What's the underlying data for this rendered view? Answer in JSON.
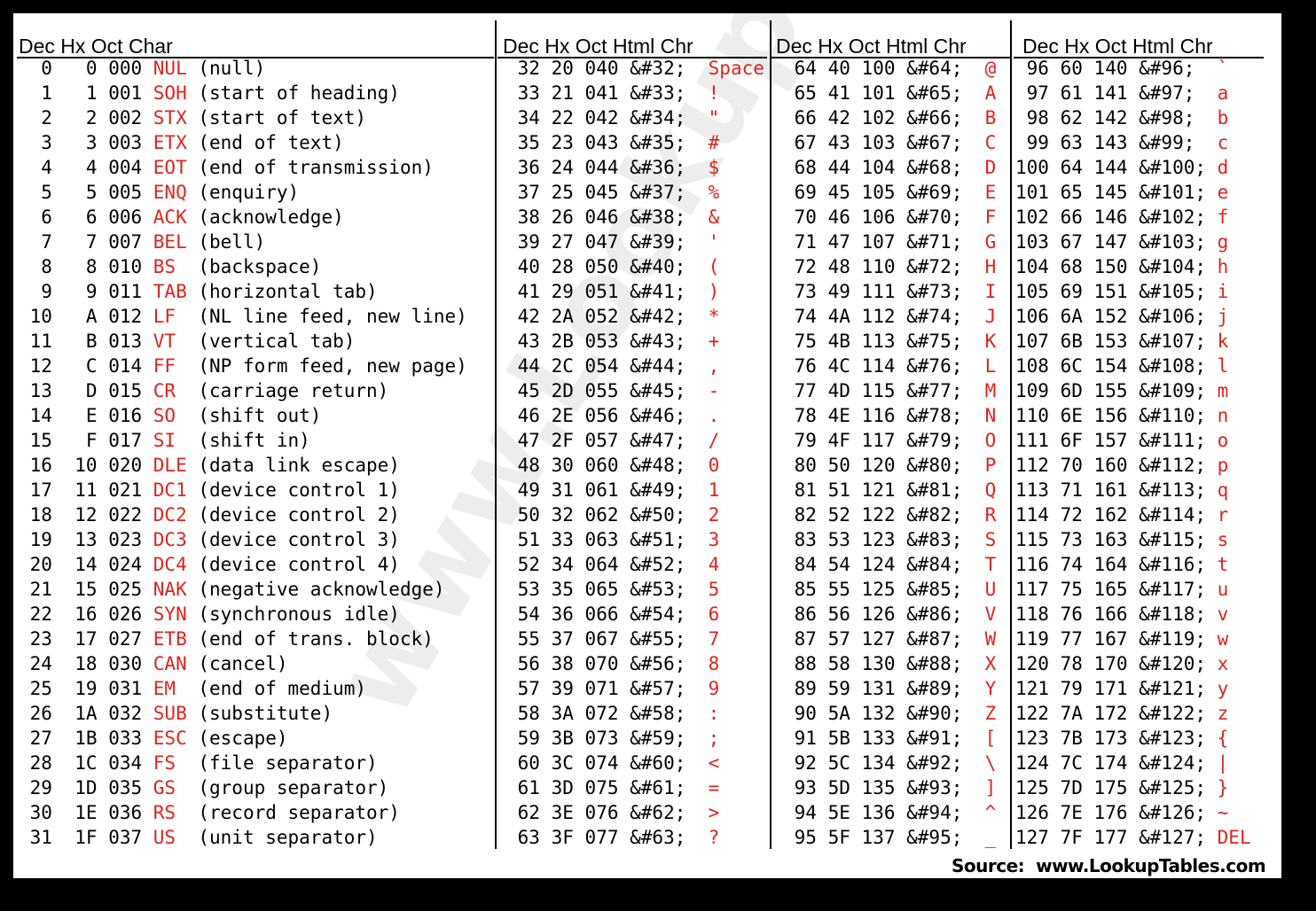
{
  "watermark": "www.LookupTables.com",
  "source": "Source:  www.LookupTables.com",
  "colors": {
    "code_red": "#e0241c"
  },
  "headers": [
    "Dec  Hx Oct  Char",
    "Dec  Hx  Oct   Html   Chr",
    "Dec  Hx  Oct  Html   Chr",
    "Dec  Hx  Oct  Html  Chr"
  ],
  "control_rows": [
    {
      "dec": "0",
      "hex": "0",
      "oct": "000",
      "abbr": "NUL",
      "desc": "(null)"
    },
    {
      "dec": "1",
      "hex": "1",
      "oct": "001",
      "abbr": "SOH",
      "desc": "(start of heading)"
    },
    {
      "dec": "2",
      "hex": "2",
      "oct": "002",
      "abbr": "STX",
      "desc": "(start of text)"
    },
    {
      "dec": "3",
      "hex": "3",
      "oct": "003",
      "abbr": "ETX",
      "desc": "(end of text)"
    },
    {
      "dec": "4",
      "hex": "4",
      "oct": "004",
      "abbr": "EOT",
      "desc": "(end of transmission)"
    },
    {
      "dec": "5",
      "hex": "5",
      "oct": "005",
      "abbr": "ENQ",
      "desc": "(enquiry)"
    },
    {
      "dec": "6",
      "hex": "6",
      "oct": "006",
      "abbr": "ACK",
      "desc": "(acknowledge)"
    },
    {
      "dec": "7",
      "hex": "7",
      "oct": "007",
      "abbr": "BEL",
      "desc": "(bell)"
    },
    {
      "dec": "8",
      "hex": "8",
      "oct": "010",
      "abbr": "BS",
      "desc": "(backspace)"
    },
    {
      "dec": "9",
      "hex": "9",
      "oct": "011",
      "abbr": "TAB",
      "desc": "(horizontal tab)"
    },
    {
      "dec": "10",
      "hex": "A",
      "oct": "012",
      "abbr": "LF",
      "desc": "(NL line feed, new line)"
    },
    {
      "dec": "11",
      "hex": "B",
      "oct": "013",
      "abbr": "VT",
      "desc": "(vertical tab)"
    },
    {
      "dec": "12",
      "hex": "C",
      "oct": "014",
      "abbr": "FF",
      "desc": "(NP form feed, new page)"
    },
    {
      "dec": "13",
      "hex": "D",
      "oct": "015",
      "abbr": "CR",
      "desc": "(carriage return)"
    },
    {
      "dec": "14",
      "hex": "E",
      "oct": "016",
      "abbr": "SO",
      "desc": "(shift out)"
    },
    {
      "dec": "15",
      "hex": "F",
      "oct": "017",
      "abbr": "SI",
      "desc": "(shift in)"
    },
    {
      "dec": "16",
      "hex": "10",
      "oct": "020",
      "abbr": "DLE",
      "desc": "(data link escape)"
    },
    {
      "dec": "17",
      "hex": "11",
      "oct": "021",
      "abbr": "DC1",
      "desc": "(device control 1)"
    },
    {
      "dec": "18",
      "hex": "12",
      "oct": "022",
      "abbr": "DC2",
      "desc": "(device control 2)"
    },
    {
      "dec": "19",
      "hex": "13",
      "oct": "023",
      "abbr": "DC3",
      "desc": "(device control 3)"
    },
    {
      "dec": "20",
      "hex": "14",
      "oct": "024",
      "abbr": "DC4",
      "desc": "(device control 4)"
    },
    {
      "dec": "21",
      "hex": "15",
      "oct": "025",
      "abbr": "NAK",
      "desc": "(negative acknowledge)"
    },
    {
      "dec": "22",
      "hex": "16",
      "oct": "026",
      "abbr": "SYN",
      "desc": "(synchronous idle)"
    },
    {
      "dec": "23",
      "hex": "17",
      "oct": "027",
      "abbr": "ETB",
      "desc": "(end of trans. block)"
    },
    {
      "dec": "24",
      "hex": "18",
      "oct": "030",
      "abbr": "CAN",
      "desc": "(cancel)"
    },
    {
      "dec": "25",
      "hex": "19",
      "oct": "031",
      "abbr": "EM",
      "desc": "(end of medium)"
    },
    {
      "dec": "26",
      "hex": "1A",
      "oct": "032",
      "abbr": "SUB",
      "desc": "(substitute)"
    },
    {
      "dec": "27",
      "hex": "1B",
      "oct": "033",
      "abbr": "ESC",
      "desc": "(escape)"
    },
    {
      "dec": "28",
      "hex": "1C",
      "oct": "034",
      "abbr": "FS",
      "desc": "(file separator)"
    },
    {
      "dec": "29",
      "hex": "1D",
      "oct": "035",
      "abbr": "GS",
      "desc": "(group separator)"
    },
    {
      "dec": "30",
      "hex": "1E",
      "oct": "036",
      "abbr": "RS",
      "desc": "(record separator)"
    },
    {
      "dec": "31",
      "hex": "1F",
      "oct": "037",
      "abbr": "US",
      "desc": "(unit separator)"
    }
  ],
  "printable_columns": [
    [
      {
        "dec": "32",
        "hex": "20",
        "oct": "040",
        "html": "&#32;",
        "chr": "Space"
      },
      {
        "dec": "33",
        "hex": "21",
        "oct": "041",
        "html": "&#33;",
        "chr": "!"
      },
      {
        "dec": "34",
        "hex": "22",
        "oct": "042",
        "html": "&#34;",
        "chr": "\""
      },
      {
        "dec": "35",
        "hex": "23",
        "oct": "043",
        "html": "&#35;",
        "chr": "#"
      },
      {
        "dec": "36",
        "hex": "24",
        "oct": "044",
        "html": "&#36;",
        "chr": "$"
      },
      {
        "dec": "37",
        "hex": "25",
        "oct": "045",
        "html": "&#37;",
        "chr": "%"
      },
      {
        "dec": "38",
        "hex": "26",
        "oct": "046",
        "html": "&#38;",
        "chr": "&"
      },
      {
        "dec": "39",
        "hex": "27",
        "oct": "047",
        "html": "&#39;",
        "chr": "'"
      },
      {
        "dec": "40",
        "hex": "28",
        "oct": "050",
        "html": "&#40;",
        "chr": "("
      },
      {
        "dec": "41",
        "hex": "29",
        "oct": "051",
        "html": "&#41;",
        "chr": ")"
      },
      {
        "dec": "42",
        "hex": "2A",
        "oct": "052",
        "html": "&#42;",
        "chr": "*"
      },
      {
        "dec": "43",
        "hex": "2B",
        "oct": "053",
        "html": "&#43;",
        "chr": "+"
      },
      {
        "dec": "44",
        "hex": "2C",
        "oct": "054",
        "html": "&#44;",
        "chr": ","
      },
      {
        "dec": "45",
        "hex": "2D",
        "oct": "055",
        "html": "&#45;",
        "chr": "-"
      },
      {
        "dec": "46",
        "hex": "2E",
        "oct": "056",
        "html": "&#46;",
        "chr": "."
      },
      {
        "dec": "47",
        "hex": "2F",
        "oct": "057",
        "html": "&#47;",
        "chr": "/"
      },
      {
        "dec": "48",
        "hex": "30",
        "oct": "060",
        "html": "&#48;",
        "chr": "0"
      },
      {
        "dec": "49",
        "hex": "31",
        "oct": "061",
        "html": "&#49;",
        "chr": "1"
      },
      {
        "dec": "50",
        "hex": "32",
        "oct": "062",
        "html": "&#50;",
        "chr": "2"
      },
      {
        "dec": "51",
        "hex": "33",
        "oct": "063",
        "html": "&#51;",
        "chr": "3"
      },
      {
        "dec": "52",
        "hex": "34",
        "oct": "064",
        "html": "&#52;",
        "chr": "4"
      },
      {
        "dec": "53",
        "hex": "35",
        "oct": "065",
        "html": "&#53;",
        "chr": "5"
      },
      {
        "dec": "54",
        "hex": "36",
        "oct": "066",
        "html": "&#54;",
        "chr": "6"
      },
      {
        "dec": "55",
        "hex": "37",
        "oct": "067",
        "html": "&#55;",
        "chr": "7"
      },
      {
        "dec": "56",
        "hex": "38",
        "oct": "070",
        "html": "&#56;",
        "chr": "8"
      },
      {
        "dec": "57",
        "hex": "39",
        "oct": "071",
        "html": "&#57;",
        "chr": "9"
      },
      {
        "dec": "58",
        "hex": "3A",
        "oct": "072",
        "html": "&#58;",
        "chr": ":"
      },
      {
        "dec": "59",
        "hex": "3B",
        "oct": "073",
        "html": "&#59;",
        "chr": ";"
      },
      {
        "dec": "60",
        "hex": "3C",
        "oct": "074",
        "html": "&#60;",
        "chr": "<"
      },
      {
        "dec": "61",
        "hex": "3D",
        "oct": "075",
        "html": "&#61;",
        "chr": "="
      },
      {
        "dec": "62",
        "hex": "3E",
        "oct": "076",
        "html": "&#62;",
        "chr": ">"
      },
      {
        "dec": "63",
        "hex": "3F",
        "oct": "077",
        "html": "&#63;",
        "chr": "?"
      }
    ],
    [
      {
        "dec": "64",
        "hex": "40",
        "oct": "100",
        "html": "&#64;",
        "chr": "@"
      },
      {
        "dec": "65",
        "hex": "41",
        "oct": "101",
        "html": "&#65;",
        "chr": "A"
      },
      {
        "dec": "66",
        "hex": "42",
        "oct": "102",
        "html": "&#66;",
        "chr": "B"
      },
      {
        "dec": "67",
        "hex": "43",
        "oct": "103",
        "html": "&#67;",
        "chr": "C"
      },
      {
        "dec": "68",
        "hex": "44",
        "oct": "104",
        "html": "&#68;",
        "chr": "D"
      },
      {
        "dec": "69",
        "hex": "45",
        "oct": "105",
        "html": "&#69;",
        "chr": "E"
      },
      {
        "dec": "70",
        "hex": "46",
        "oct": "106",
        "html": "&#70;",
        "chr": "F"
      },
      {
        "dec": "71",
        "hex": "47",
        "oct": "107",
        "html": "&#71;",
        "chr": "G"
      },
      {
        "dec": "72",
        "hex": "48",
        "oct": "110",
        "html": "&#72;",
        "chr": "H"
      },
      {
        "dec": "73",
        "hex": "49",
        "oct": "111",
        "html": "&#73;",
        "chr": "I"
      },
      {
        "dec": "74",
        "hex": "4A",
        "oct": "112",
        "html": "&#74;",
        "chr": "J"
      },
      {
        "dec": "75",
        "hex": "4B",
        "oct": "113",
        "html": "&#75;",
        "chr": "K"
      },
      {
        "dec": "76",
        "hex": "4C",
        "oct": "114",
        "html": "&#76;",
        "chr": "L"
      },
      {
        "dec": "77",
        "hex": "4D",
        "oct": "115",
        "html": "&#77;",
        "chr": "M"
      },
      {
        "dec": "78",
        "hex": "4E",
        "oct": "116",
        "html": "&#78;",
        "chr": "N"
      },
      {
        "dec": "79",
        "hex": "4F",
        "oct": "117",
        "html": "&#79;",
        "chr": "O"
      },
      {
        "dec": "80",
        "hex": "50",
        "oct": "120",
        "html": "&#80;",
        "chr": "P"
      },
      {
        "dec": "81",
        "hex": "51",
        "oct": "121",
        "html": "&#81;",
        "chr": "Q"
      },
      {
        "dec": "82",
        "hex": "52",
        "oct": "122",
        "html": "&#82;",
        "chr": "R"
      },
      {
        "dec": "83",
        "hex": "53",
        "oct": "123",
        "html": "&#83;",
        "chr": "S"
      },
      {
        "dec": "84",
        "hex": "54",
        "oct": "124",
        "html": "&#84;",
        "chr": "T"
      },
      {
        "dec": "85",
        "hex": "55",
        "oct": "125",
        "html": "&#85;",
        "chr": "U"
      },
      {
        "dec": "86",
        "hex": "56",
        "oct": "126",
        "html": "&#86;",
        "chr": "V"
      },
      {
        "dec": "87",
        "hex": "57",
        "oct": "127",
        "html": "&#87;",
        "chr": "W"
      },
      {
        "dec": "88",
        "hex": "58",
        "oct": "130",
        "html": "&#88;",
        "chr": "X"
      },
      {
        "dec": "89",
        "hex": "59",
        "oct": "131",
        "html": "&#89;",
        "chr": "Y"
      },
      {
        "dec": "90",
        "hex": "5A",
        "oct": "132",
        "html": "&#90;",
        "chr": "Z"
      },
      {
        "dec": "91",
        "hex": "5B",
        "oct": "133",
        "html": "&#91;",
        "chr": "["
      },
      {
        "dec": "92",
        "hex": "5C",
        "oct": "134",
        "html": "&#92;",
        "chr": "\\"
      },
      {
        "dec": "93",
        "hex": "5D",
        "oct": "135",
        "html": "&#93;",
        "chr": "]"
      },
      {
        "dec": "94",
        "hex": "5E",
        "oct": "136",
        "html": "&#94;",
        "chr": "^"
      },
      {
        "dec": "95",
        "hex": "5F",
        "oct": "137",
        "html": "&#95;",
        "chr": "_"
      }
    ],
    [
      {
        "dec": "96",
        "hex": "60",
        "oct": "140",
        "html": "&#96;",
        "chr": "`"
      },
      {
        "dec": "97",
        "hex": "61",
        "oct": "141",
        "html": "&#97;",
        "chr": "a"
      },
      {
        "dec": "98",
        "hex": "62",
        "oct": "142",
        "html": "&#98;",
        "chr": "b"
      },
      {
        "dec": "99",
        "hex": "63",
        "oct": "143",
        "html": "&#99;",
        "chr": "c"
      },
      {
        "dec": "100",
        "hex": "64",
        "oct": "144",
        "html": "&#100;",
        "chr": "d"
      },
      {
        "dec": "101",
        "hex": "65",
        "oct": "145",
        "html": "&#101;",
        "chr": "e"
      },
      {
        "dec": "102",
        "hex": "66",
        "oct": "146",
        "html": "&#102;",
        "chr": "f"
      },
      {
        "dec": "103",
        "hex": "67",
        "oct": "147",
        "html": "&#103;",
        "chr": "g"
      },
      {
        "dec": "104",
        "hex": "68",
        "oct": "150",
        "html": "&#104;",
        "chr": "h"
      },
      {
        "dec": "105",
        "hex": "69",
        "oct": "151",
        "html": "&#105;",
        "chr": "i"
      },
      {
        "dec": "106",
        "hex": "6A",
        "oct": "152",
        "html": "&#106;",
        "chr": "j"
      },
      {
        "dec": "107",
        "hex": "6B",
        "oct": "153",
        "html": "&#107;",
        "chr": "k"
      },
      {
        "dec": "108",
        "hex": "6C",
        "oct": "154",
        "html": "&#108;",
        "chr": "l"
      },
      {
        "dec": "109",
        "hex": "6D",
        "oct": "155",
        "html": "&#109;",
        "chr": "m"
      },
      {
        "dec": "110",
        "hex": "6E",
        "oct": "156",
        "html": "&#110;",
        "chr": "n"
      },
      {
        "dec": "111",
        "hex": "6F",
        "oct": "157",
        "html": "&#111;",
        "chr": "o"
      },
      {
        "dec": "112",
        "hex": "70",
        "oct": "160",
        "html": "&#112;",
        "chr": "p"
      },
      {
        "dec": "113",
        "hex": "71",
        "oct": "161",
        "html": "&#113;",
        "chr": "q"
      },
      {
        "dec": "114",
        "hex": "72",
        "oct": "162",
        "html": "&#114;",
        "chr": "r"
      },
      {
        "dec": "115",
        "hex": "73",
        "oct": "163",
        "html": "&#115;",
        "chr": "s"
      },
      {
        "dec": "116",
        "hex": "74",
        "oct": "164",
        "html": "&#116;",
        "chr": "t"
      },
      {
        "dec": "117",
        "hex": "75",
        "oct": "165",
        "html": "&#117;",
        "chr": "u"
      },
      {
        "dec": "118",
        "hex": "76",
        "oct": "166",
        "html": "&#118;",
        "chr": "v"
      },
      {
        "dec": "119",
        "hex": "77",
        "oct": "167",
        "html": "&#119;",
        "chr": "w"
      },
      {
        "dec": "120",
        "hex": "78",
        "oct": "170",
        "html": "&#120;",
        "chr": "x"
      },
      {
        "dec": "121",
        "hex": "79",
        "oct": "171",
        "html": "&#121;",
        "chr": "y"
      },
      {
        "dec": "122",
        "hex": "7A",
        "oct": "172",
        "html": "&#122;",
        "chr": "z"
      },
      {
        "dec": "123",
        "hex": "7B",
        "oct": "173",
        "html": "&#123;",
        "chr": "{"
      },
      {
        "dec": "124",
        "hex": "7C",
        "oct": "174",
        "html": "&#124;",
        "chr": "|"
      },
      {
        "dec": "125",
        "hex": "7D",
        "oct": "175",
        "html": "&#125;",
        "chr": "}"
      },
      {
        "dec": "126",
        "hex": "7E",
        "oct": "176",
        "html": "&#126;",
        "chr": "~"
      },
      {
        "dec": "127",
        "hex": "7F",
        "oct": "177",
        "html": "&#127;",
        "chr": "DEL"
      }
    ]
  ]
}
